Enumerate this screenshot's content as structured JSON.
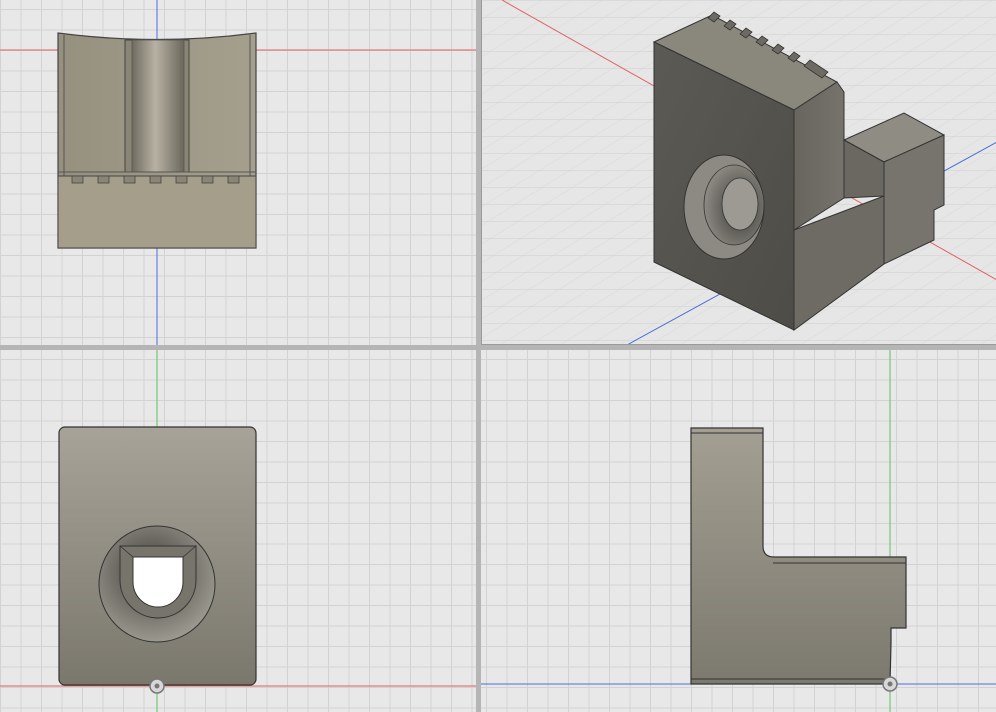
{
  "app": {
    "view_layout": "four-viewport",
    "viewports": [
      {
        "id": "top",
        "projection": "orthographic-top",
        "axes_shown": [
          "x-axis",
          "y-axis"
        ]
      },
      {
        "id": "home",
        "projection": "isometric",
        "axes_shown": [
          "x-axis",
          "z-axis",
          "y-axis"
        ]
      },
      {
        "id": "front",
        "projection": "orthographic-front",
        "axes_shown": [
          "x-axis",
          "z-axis"
        ]
      },
      {
        "id": "right",
        "projection": "orthographic-right",
        "axes_shown": [
          "y-axis",
          "z-axis"
        ]
      }
    ]
  },
  "colors": {
    "background": "#e8e8e8",
    "grid_line": "#d3d3d3",
    "x_axis": "#e06060",
    "y_axis": "#4a6ed8",
    "z_axis": "#60c060",
    "part_body": "#8f8b7e",
    "part_dark": "#5e5c55",
    "divider": "#b5b5b5"
  },
  "icons": [
    "origin-pivot-icon"
  ]
}
